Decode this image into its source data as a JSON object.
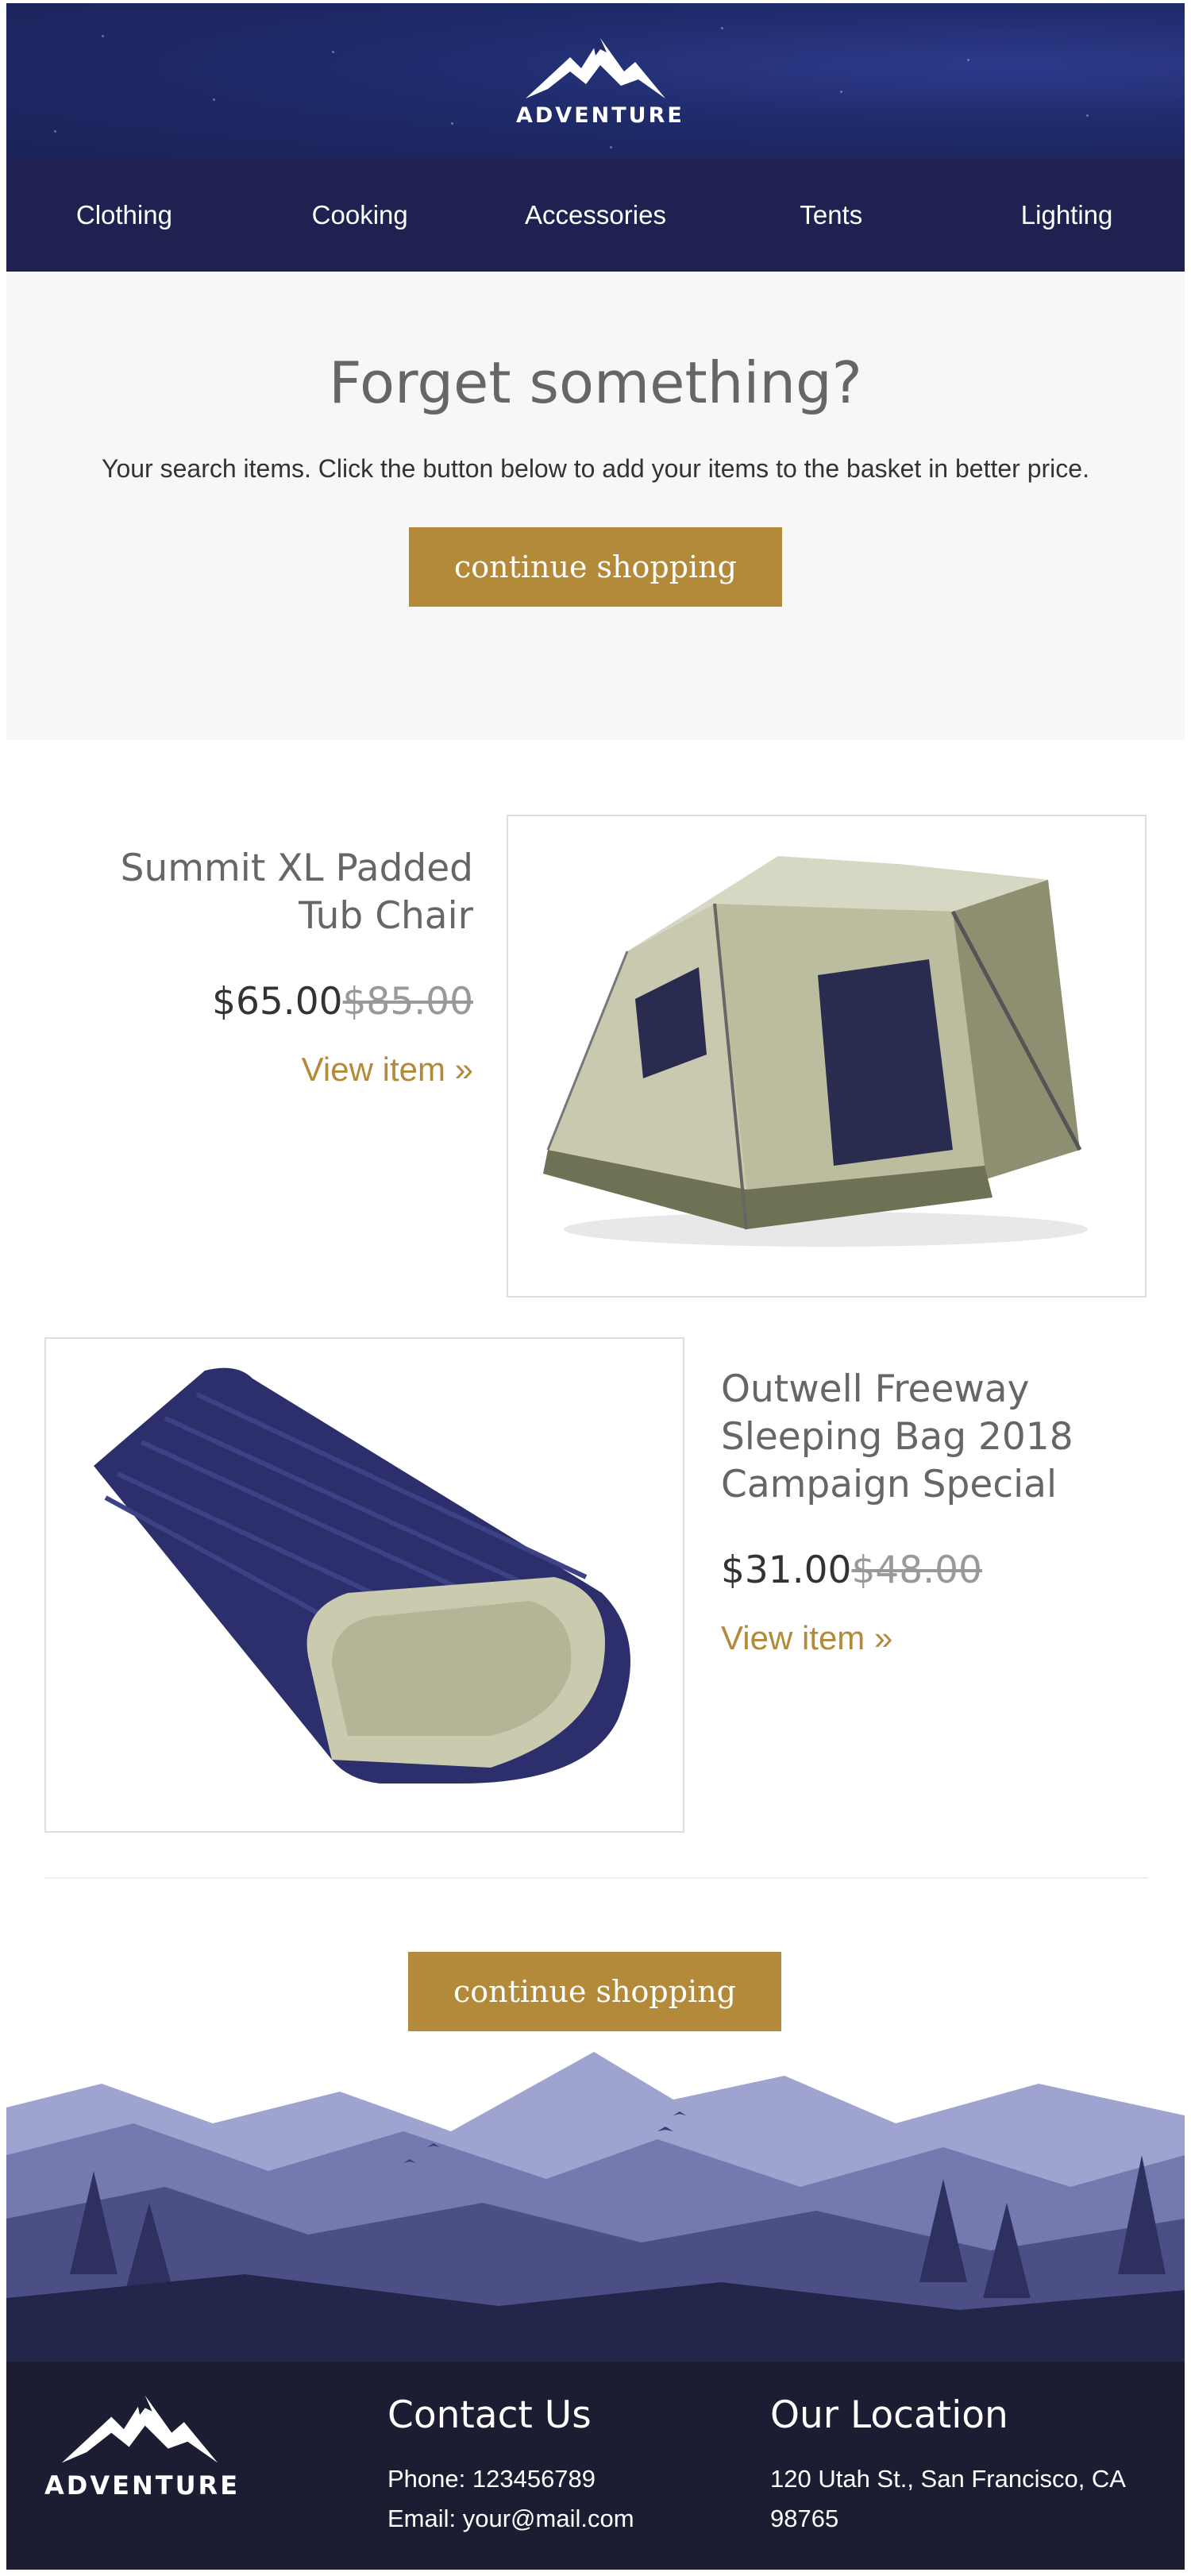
{
  "brand": {
    "name": "ADVENTURE",
    "accent": "#b38a3a",
    "header_bg": "#1f2250",
    "footer_bg": "#1c1c33"
  },
  "nav": {
    "items": [
      {
        "label": "Clothing"
      },
      {
        "label": "Cooking"
      },
      {
        "label": "Accessories"
      },
      {
        "label": "Tents"
      },
      {
        "label": "Lighting"
      }
    ]
  },
  "intro": {
    "heading": "Forget something?",
    "body": "Your search items. Click the button below to add your items to the basket in better price.",
    "cta": "continue shopping"
  },
  "products": [
    {
      "title": "Summit XL Padded Tub Chair",
      "price": "$65.00",
      "old_price": "$85.00",
      "link": "View item »",
      "image": "tent-image"
    },
    {
      "title": "Outwell Freeway Sleeping Bag 2018 Campaign Special",
      "price": "$31.00",
      "old_price": "$48.00",
      "link": "View item »",
      "image": "sleeping-bag-image"
    }
  ],
  "bottom_cta": "continue shopping",
  "footer": {
    "contact": {
      "heading": "Contact Us",
      "phone": "Phone: 123456789",
      "email": "Email: your@mail.com"
    },
    "location": {
      "heading": "Our Location",
      "address_line1": "120 Utah St., San Francisco, CA",
      "address_line2": "98765"
    }
  }
}
